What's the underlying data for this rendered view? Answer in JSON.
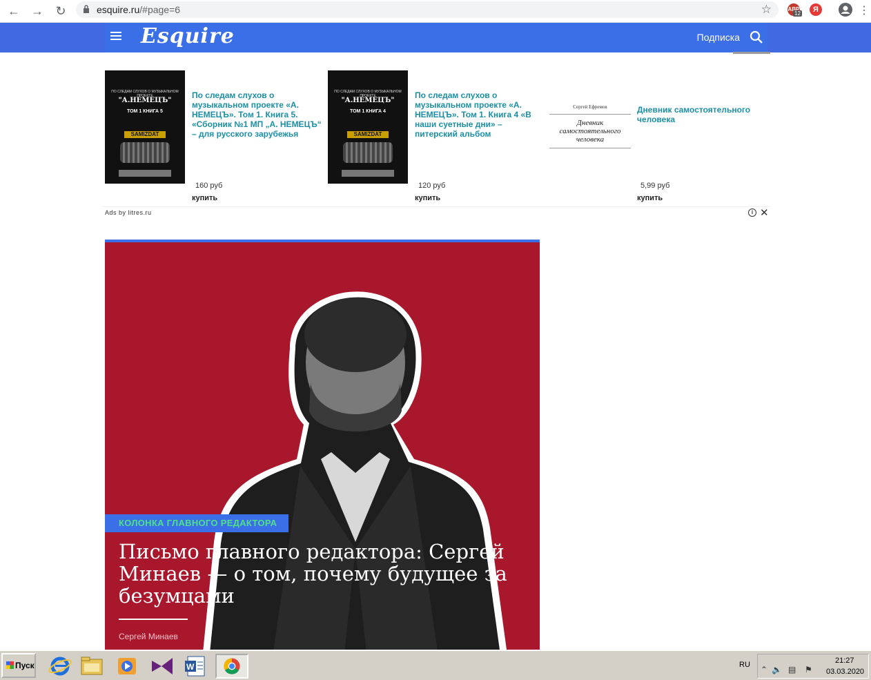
{
  "browser": {
    "url_host": "esquire.ru",
    "url_path": "/#page=6",
    "ext_badge": "12",
    "ext_abp": "ABP",
    "ext_ya": "Я"
  },
  "header": {
    "logo": "Esquire",
    "subscribe": "Подписка"
  },
  "ad": {
    "items": [
      {
        "title": "По следам слухов о музыкальном проекте «А. НЕМЕЦЪ». Том 1. Книга 5. «Сборник №1 МП „А. НЕМЕЦЪ“ – для русского зарубежья",
        "price": "160 руб",
        "buy": "купить"
      },
      {
        "title": "По следам слухов о музыкальном проекте «А. НЕМЕЦЪ». Том 1. Книга 4 «В наши суетные дни» – питерский альбом",
        "price": "120 руб",
        "buy": "купить"
      },
      {
        "title": "Дневник самостоятельного человека",
        "price": "5,99 руб",
        "buy": "купить"
      }
    ],
    "book_cover": {
      "top": "ПО СЛЕДАМ СЛУХОВ О МУЗЫКАЛЬНОМ ПРОЕКТЕ",
      "name": "\"А.НЕМЕЦЪ\"",
      "brand": "SAMIZDAT",
      "vol5": "ТОМ 1  КНИГА 5",
      "vol4": "ТОМ 1  КНИГА 4"
    },
    "white_cover": {
      "author": "Сергей Ефремов",
      "title": "Дневник самостоятельного человека"
    },
    "ads_by": "Ads by litres.ru"
  },
  "feature": {
    "tag": "КОЛОНКА ГЛАВНОГО РЕДАКТОРА",
    "title": "Письмо главного редактора: Сергей Минаев — о том, почему будущее за безумцами",
    "author": "Сергей Минаев"
  },
  "taskbar": {
    "start": "Пуск",
    "lang": "RU",
    "time": "21:27",
    "date": "03.03.2020"
  }
}
